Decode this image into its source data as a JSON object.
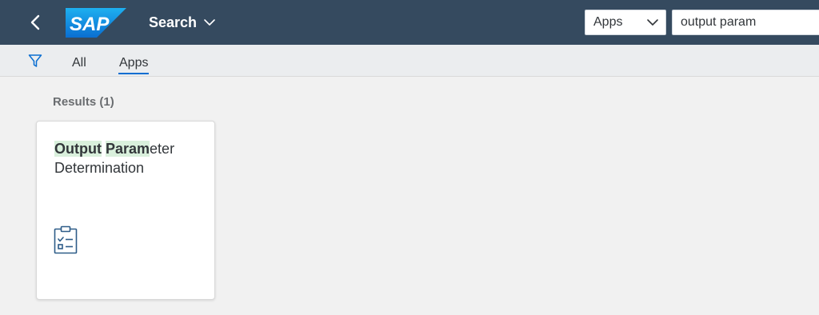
{
  "shellbar": {
    "logo_text": "SAP",
    "title": "Search",
    "scope": {
      "selected": "Apps"
    },
    "search": {
      "value": "output param"
    },
    "colors": {
      "background": "#354a5f",
      "logo": "#0a6ed1"
    }
  },
  "filter_bar": {
    "tabs": [
      {
        "label": "All",
        "selected": false
      },
      {
        "label": "Apps",
        "selected": true
      }
    ]
  },
  "results": {
    "label": "Results (1)",
    "tiles": [
      {
        "title_parts": [
          {
            "text": "Output",
            "highlight": true
          },
          {
            "text": " ",
            "highlight": false
          },
          {
            "text": "Param",
            "highlight": true
          },
          {
            "text": "eter",
            "highlight": false
          }
        ],
        "title_line2": "Determination",
        "icon": "checklist-icon"
      }
    ]
  }
}
